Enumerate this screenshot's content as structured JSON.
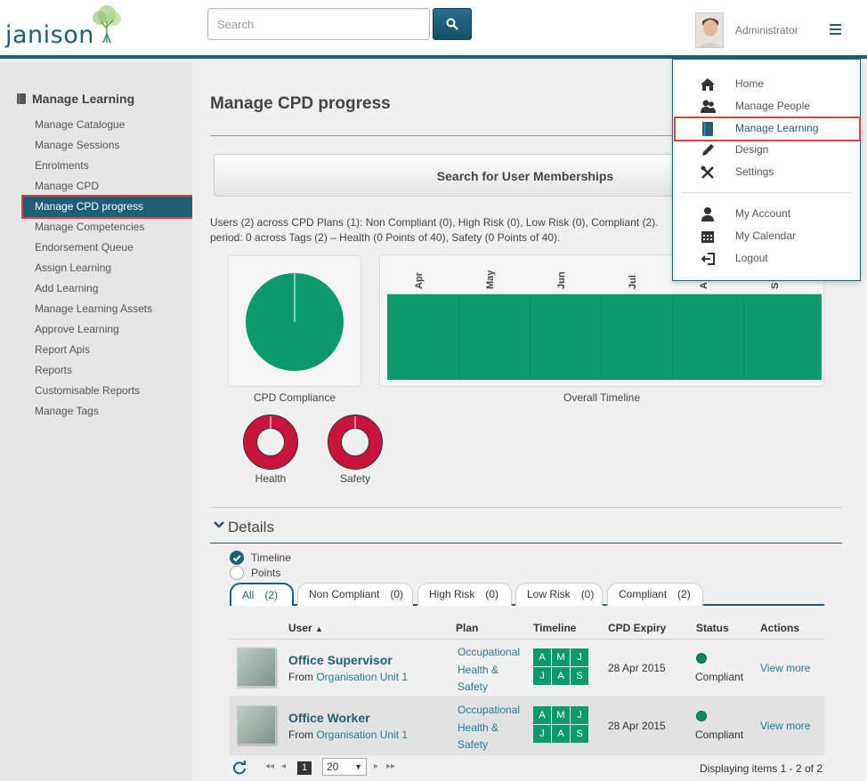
{
  "header": {
    "logo_text": "janison",
    "search_placeholder": "Search",
    "user_name": "Administrator"
  },
  "sidebar": {
    "title": "Manage Learning",
    "items": [
      {
        "label": "Manage Catalogue",
        "active": false
      },
      {
        "label": "Manage Sessions",
        "active": false
      },
      {
        "label": "Enrolments",
        "active": false
      },
      {
        "label": "Manage CPD",
        "active": false
      },
      {
        "label": "Manage CPD progress",
        "active": true
      },
      {
        "label": "Manage Competencies",
        "active": false
      },
      {
        "label": "Endorsement Queue",
        "active": false
      },
      {
        "label": "Assign Learning",
        "active": false
      },
      {
        "label": "Add Learning",
        "active": false
      },
      {
        "label": "Manage Learning Assets",
        "active": false
      },
      {
        "label": "Approve Learning",
        "active": false
      },
      {
        "label": "Report Apis",
        "active": false
      },
      {
        "label": "Reports",
        "active": false
      },
      {
        "label": "Customisable Reports",
        "active": false
      },
      {
        "label": "Manage Tags",
        "active": false
      }
    ]
  },
  "main": {
    "page_title": "Manage CPD progress",
    "search_button": "Search for User Memberships",
    "summary_line1": "Users (2) across CPD Plans (1): Non Compliant (0), High Risk (0), Low Risk (0), Compliant (2).",
    "summary_line2": "period: 0 across Tags (2) – Health (0 Points of 40), Safety (0 Points of 40)."
  },
  "charts": {
    "compliance_caption": "CPD Compliance",
    "timeline_caption": "Overall Timeline",
    "timeline_months": [
      "Apr",
      "May",
      "Jun",
      "Jul",
      "A",
      "S"
    ],
    "health_caption": "Health",
    "safety_caption": "Safety"
  },
  "details": {
    "title": "Details",
    "options": [
      "Timeline",
      "Points"
    ],
    "selected_option": "Timeline",
    "tabs": [
      {
        "label": "All",
        "count": "(2)"
      },
      {
        "label": "Non Compliant",
        "count": "(0)"
      },
      {
        "label": "High Risk",
        "count": "(0)"
      },
      {
        "label": "Low Risk",
        "count": "(0)"
      },
      {
        "label": "Compliant",
        "count": "(2)"
      }
    ],
    "columns": {
      "user": "User",
      "plan": "Plan",
      "timeline": "Timeline",
      "expiry": "CPD Expiry",
      "status": "Status",
      "actions": "Actions"
    },
    "rows": [
      {
        "name": "Office Supervisor",
        "from_prefix": "From",
        "org_unit": "Organisation Unit 1",
        "plan_lines": [
          "Occupational",
          "Health &",
          "Safety"
        ],
        "timeline": [
          "A",
          "M",
          "J",
          "J",
          "A",
          "S"
        ],
        "expiry": "28 Apr 2015",
        "status": "Compliant",
        "action": "View more"
      },
      {
        "name": "Office Worker",
        "from_prefix": "From",
        "org_unit": "Organisation Unit 1",
        "plan_lines": [
          "Occupational",
          "Health &",
          "Safety"
        ],
        "timeline": [
          "A",
          "M",
          "J",
          "J",
          "A",
          "S"
        ],
        "expiry": "28 Apr 2015",
        "status": "Compliant",
        "action": "View more"
      }
    ],
    "pager": {
      "current_page": "1",
      "page_size": "20",
      "info": "Displaying items 1 - 2 of 2"
    }
  },
  "menu": {
    "items": [
      {
        "label": "Home",
        "icon": "home-icon"
      },
      {
        "label": "Manage People",
        "icon": "people-icon"
      },
      {
        "label": "Manage Learning",
        "icon": "book-icon"
      },
      {
        "label": "Design",
        "icon": "pencil-icon"
      },
      {
        "label": "Settings",
        "icon": "tools-icon"
      },
      {
        "label": "My Account",
        "icon": "user-icon"
      },
      {
        "label": "My Calendar",
        "icon": "calendar-icon"
      },
      {
        "label": "Logout",
        "icon": "logout-icon"
      }
    ],
    "active_label": "Manage Learning"
  },
  "colors": {
    "brand": "#1f5e77",
    "chart_green": "#0a9a6b",
    "chart_red": "#c8143c",
    "highlight": "#d94040"
  }
}
